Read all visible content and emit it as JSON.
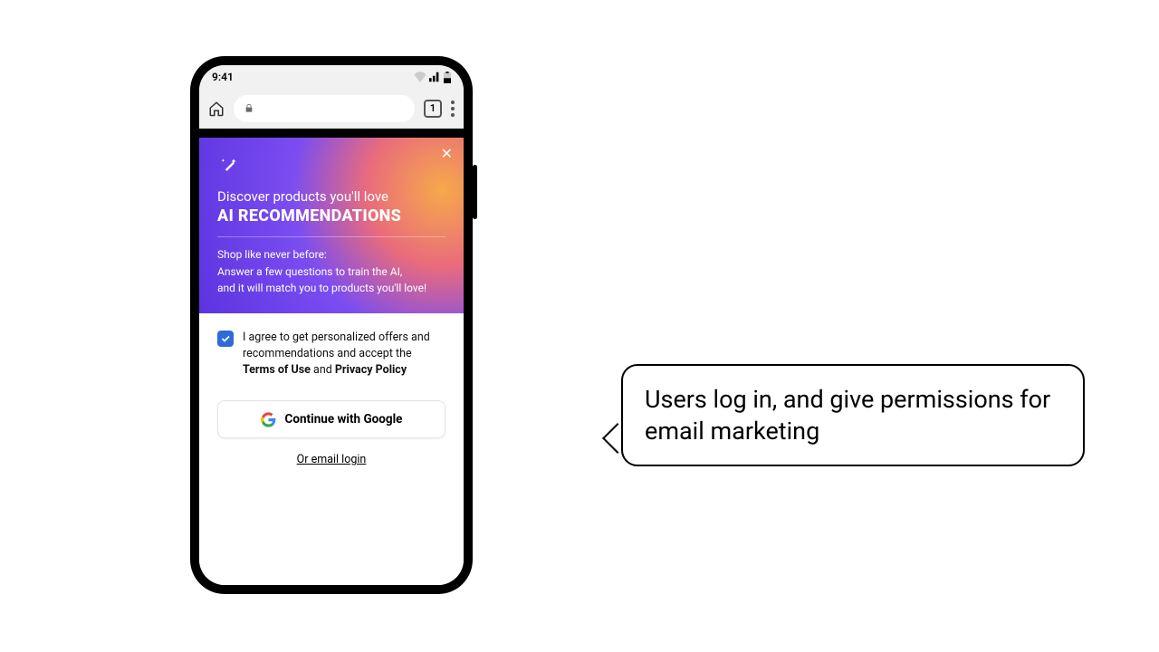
{
  "status": {
    "time": "9:41",
    "tab_count": "1"
  },
  "hero": {
    "subheading": "Discover products you'll love",
    "title": "AI RECOMMENDATIONS",
    "body_line1": "Shop like never before:",
    "body_line2": "Answer a few questions to train the AI,",
    "body_line3": "and it will match you to products you'll love!"
  },
  "consent": {
    "text_pre": "I agree to get personalized offers and recommendations and accept the ",
    "terms": "Terms of Use",
    "and": " and ",
    "privacy": "Privacy Policy"
  },
  "buttons": {
    "google": "Continue with Google",
    "email": "Or email login"
  },
  "callout": {
    "text": "Users log in, and give permissions for email marketing"
  }
}
